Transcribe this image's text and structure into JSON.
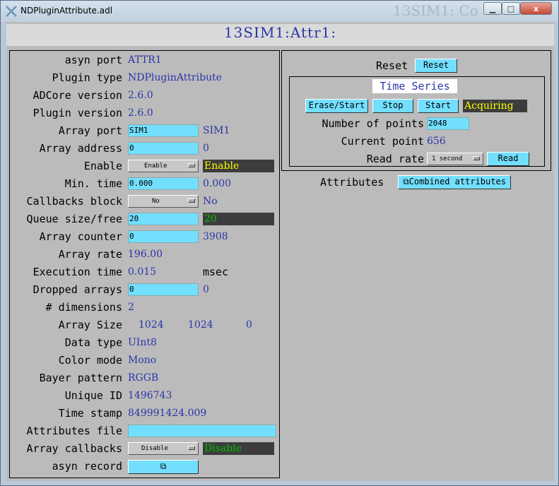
{
  "window": {
    "title": "NDPluginAttribute.adl",
    "ghost_text": "13SIM1: Co",
    "min_glyph": "▁",
    "max_glyph": "□",
    "close_glyph": "x"
  },
  "header": {
    "title": "13SIM1:Attr1:"
  },
  "left": {
    "labels": {
      "asyn_port": "asyn port",
      "plugin_type": "Plugin type",
      "adcore_version": "ADCore version",
      "plugin_version": "Plugin version",
      "array_port": "Array port",
      "array_address": "Array address",
      "enable": "Enable",
      "min_time": "Min. time",
      "callbacks_block": "Callbacks block",
      "queue_size_free": "Queue size/free",
      "array_counter": "Array counter",
      "array_rate": "Array rate",
      "execution_time": "Execution time",
      "dropped_arrays": "Dropped arrays",
      "dimensions": "# dimensions",
      "array_size": "Array Size",
      "data_type": "Data type",
      "color_mode": "Color mode",
      "bayer_pattern": "Bayer pattern",
      "unique_id": "Unique ID",
      "time_stamp": "Time stamp",
      "attributes_file": "Attributes file",
      "array_callbacks": "Array callbacks",
      "asyn_record": "asyn record"
    },
    "values": {
      "asyn_port": "ATTR1",
      "plugin_type": "NDPluginAttribute",
      "adcore_version": "2.6.0",
      "plugin_version": "2.6.0",
      "array_port_input": "SIM1",
      "array_port_rbv": "SIM1",
      "array_address_input": "0",
      "array_address_rbv": "0",
      "enable_select": "Enable",
      "enable_rbv": "Enable",
      "min_time_input": "0.000",
      "min_time_rbv": "0.000",
      "callbacks_block_select": "No",
      "callbacks_block_rbv": "No",
      "queue_size_input": "20",
      "queue_free_rbv": "20",
      "array_counter_input": "0",
      "array_counter_rbv": "3908",
      "array_rate": "196.00",
      "execution_time": "0.015",
      "execution_time_unit": "msec",
      "dropped_arrays_input": "0",
      "dropped_arrays_rbv": "0",
      "dimensions": "2",
      "array_size_x": "1024",
      "array_size_y": "1024",
      "array_size_z": "0",
      "data_type": "UInt8",
      "color_mode": "Mono",
      "bayer_pattern": "RGGB",
      "unique_id": "1496743",
      "time_stamp": "849991424.009",
      "attributes_file_input": "",
      "array_callbacks_select": "Disable",
      "array_callbacks_rbv": "Disable",
      "asyn_record_button": "⧉"
    }
  },
  "right": {
    "reset_label": "Reset",
    "reset_button": "Reset",
    "time_series": {
      "title": "Time Series",
      "erase_start": "Erase/Start",
      "stop": "Stop",
      "start": "Start",
      "status": "Acquiring",
      "num_points_label": "Number of points",
      "num_points_input": "2048",
      "current_point_label": "Current point",
      "current_point": "656",
      "read_rate_label": "Read rate",
      "read_rate_select": "1 second",
      "read_button": "Read"
    },
    "attributes_label": "Attributes",
    "combined_attributes_button": "⧉Combined attributes"
  },
  "colors": {
    "value_blue": "#2a35a8",
    "input_cyan": "#73dfff",
    "enable_yellow": "#ffff00",
    "disable_green": "#00c000",
    "panel_gray": "#bbbbbb"
  }
}
